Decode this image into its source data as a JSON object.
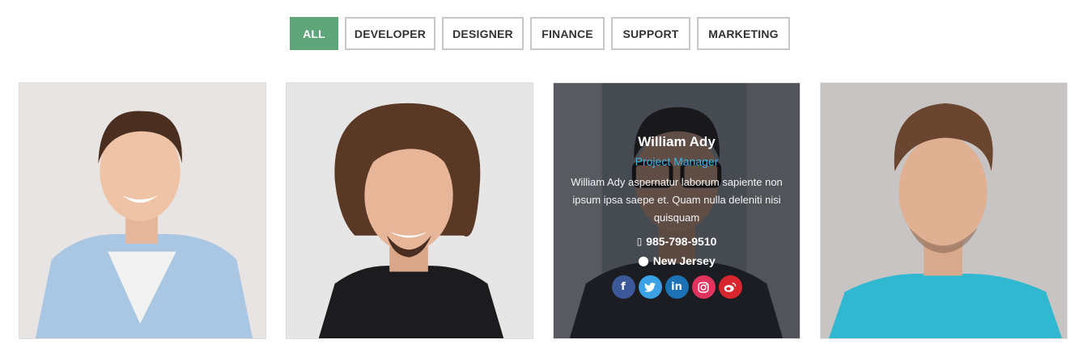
{
  "filters": [
    {
      "label": "ALL",
      "active": true
    },
    {
      "label": "DEVELOPER",
      "active": false
    },
    {
      "label": "DESIGNER",
      "active": false
    },
    {
      "label": "FINANCE",
      "active": false
    },
    {
      "label": "SUPPORT",
      "active": false
    },
    {
      "label": "MARKETING",
      "active": false
    }
  ],
  "team": {
    "featured": {
      "name": "William Ady",
      "role": "Project Manager",
      "bio": "William Ady aspernatur laborum sapiente non ipsum ipsa saepe et. Quam nulla deleniti nisi quisquam",
      "phone": "985-798-9510",
      "location": "New Jersey"
    },
    "socials": [
      {
        "name": "facebook-icon",
        "glyph": "f",
        "color": "#3b5998"
      },
      {
        "name": "twitter-icon",
        "glyph": "🐦",
        "color": "#3aa1e4"
      },
      {
        "name": "linkedin-icon",
        "glyph": "in",
        "color": "#1d72b5"
      },
      {
        "name": "instagram-icon",
        "glyph": "◎",
        "color": "#e0345e"
      },
      {
        "name": "weibo-icon",
        "glyph": "◉",
        "color": "#d7262e"
      }
    ]
  },
  "colors": {
    "accent": "#5fa57a",
    "role": "#38b6e6"
  }
}
